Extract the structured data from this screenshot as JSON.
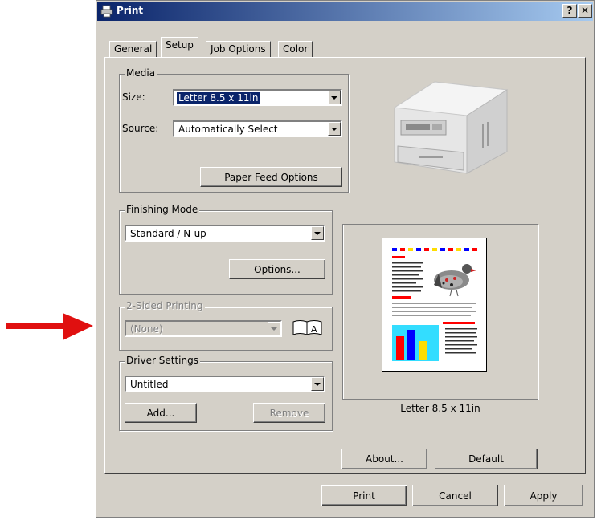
{
  "window": {
    "title": "Print",
    "help_label": "?",
    "close_label": "✕"
  },
  "tabs": [
    {
      "label": "General"
    },
    {
      "label": "Setup"
    },
    {
      "label": "Job Options"
    },
    {
      "label": "Color"
    }
  ],
  "media": {
    "legend": "Media",
    "size_label": "Size:",
    "size_value": "Letter 8.5 x 11in",
    "source_label": "Source:",
    "source_value": "Automatically Select",
    "paper_feed_button": "Paper Feed Options"
  },
  "finishing": {
    "legend": "Finishing Mode",
    "value": "Standard / N-up",
    "options_button": "Options..."
  },
  "two_sided": {
    "legend": "2-Sided Printing",
    "value": "(None)",
    "book_icon_letter": "A"
  },
  "driver": {
    "legend": "Driver Settings",
    "value": "Untitled",
    "add_button": "Add...",
    "remove_button": "Remove"
  },
  "preview": {
    "caption": "Letter 8.5 x 11in"
  },
  "buttons": {
    "about": "About...",
    "default": "Default",
    "print": "Print",
    "cancel": "Cancel",
    "apply": "Apply"
  },
  "colors": {
    "arrow": "#e01010",
    "title_bar": "#0a246a",
    "selection": "#0a246a"
  }
}
